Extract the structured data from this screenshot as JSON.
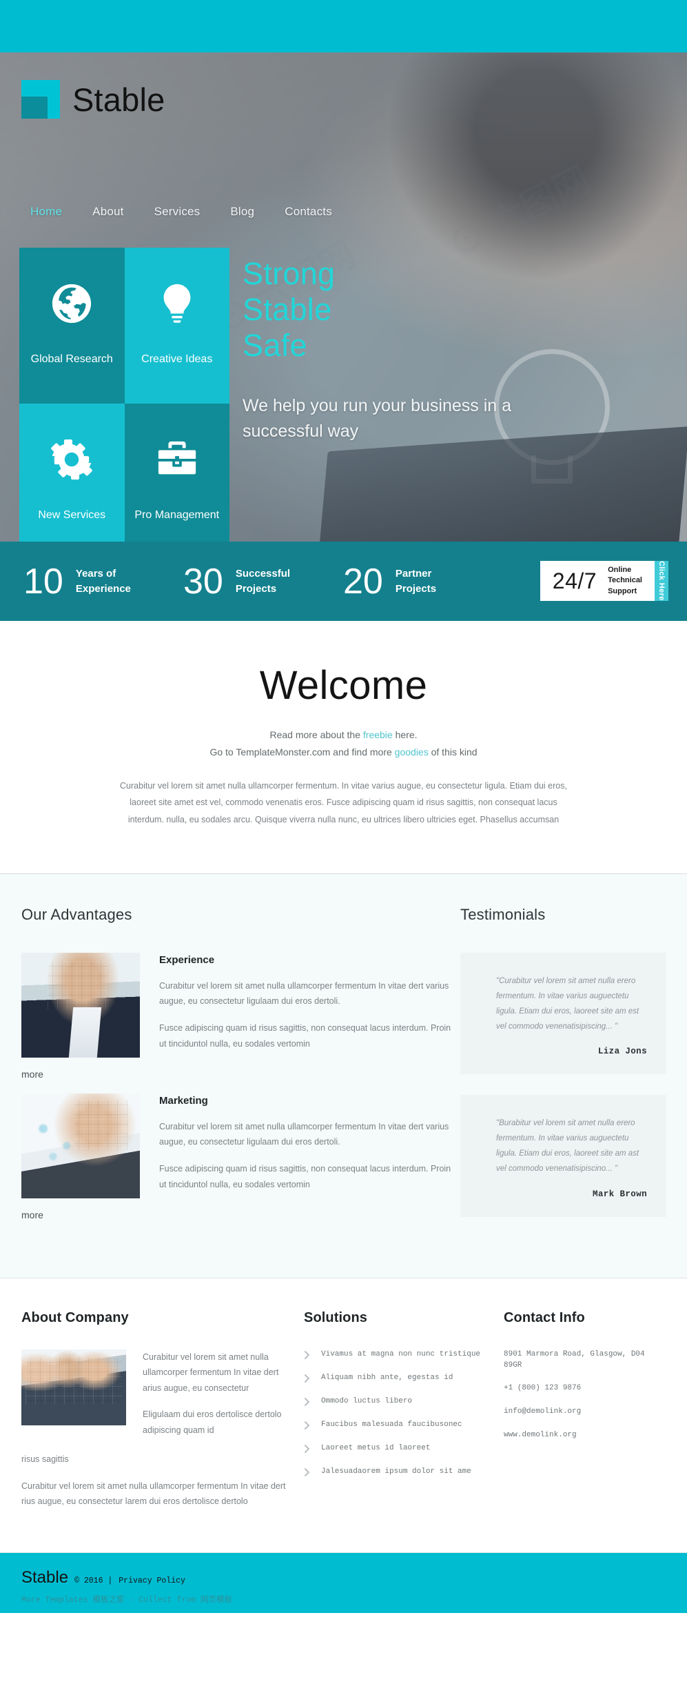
{
  "brand": {
    "name": "Stable"
  },
  "nav": {
    "items": [
      {
        "label": "Home",
        "active": true
      },
      {
        "label": "About",
        "active": false
      },
      {
        "label": "Services",
        "active": false
      },
      {
        "label": "Blog",
        "active": false
      },
      {
        "label": "Contacts",
        "active": false
      }
    ]
  },
  "tiles": [
    {
      "label": "Global Research",
      "icon": "globe-icon",
      "tone": "dark"
    },
    {
      "label": "Creative Ideas",
      "icon": "lightbulb-icon",
      "tone": "light"
    },
    {
      "label": "New Services",
      "icon": "gear-icon",
      "tone": "light"
    },
    {
      "label": "Pro Management",
      "icon": "briefcase-icon",
      "tone": "dark"
    }
  ],
  "hero": {
    "line1": "Strong",
    "line2": "Stable",
    "line3": "Safe",
    "subtitle": "We help you run your business in a successful way"
  },
  "stats": [
    {
      "number": "10",
      "label": "Years of Experience"
    },
    {
      "number": "30",
      "label": "Successful Projects"
    },
    {
      "number": "20",
      "label": "Partner Projects"
    }
  ],
  "support": {
    "hours": "24/7",
    "line1": "Online",
    "line2": "Technical",
    "line3": "Support",
    "cta": "Click Here"
  },
  "welcome": {
    "title": "Welcome",
    "lead_pre": "Read more about the ",
    "lead_link1": "freebie",
    "lead_mid": " here.",
    "lead_line2_pre": "Go to TemplateMonster.com and find more ",
    "lead_link2": "goodies",
    "lead_line2_post": " of this kind",
    "body": "Curabitur vel lorem sit amet nulla ullamcorper fermentum. In vitae varius augue, eu consectetur ligula. Etiam dui eros, laoreet site amet est vel, commodo venenatis eros. Fusce adipiscing quam id risus sagittis, non consequat lacus interdum. nulla, eu sodales arcu. Quisque viverra nulla nunc, eu ultrices libero ultricies eget. Phasellus accumsan"
  },
  "advantages": {
    "heading": "Our Advantages",
    "items": [
      {
        "title": "Experience",
        "para1": "Curabitur vel lorem sit amet nulla ullamcorper fermentum In vitae dert varius augue, eu consectetur ligulaam dui eros dertoli.",
        "para2": "Fusce adipiscing quam id risus sagittis, non consequat lacus interdum. Proin ut tinciduntol nulla, eu sodales vertomin",
        "more": "more",
        "photo": "businesswoman-photo"
      },
      {
        "title": "Marketing",
        "para1": "Curabitur vel lorem sit amet nulla ullamcorper fermentum In vitae dert varius augue, eu consectetur ligulaam dui eros dertoli.",
        "para2": "Fusce adipiscing quam id risus sagittis, non consequat lacus interdum. Proin ut tinciduntol nulla, eu sodales vertomin",
        "more": "more",
        "photo": "businessman-chart-photo"
      }
    ]
  },
  "testimonials": {
    "heading": "Testimonials",
    "items": [
      {
        "quote": "\"Curabitur vel lorem sit amet nulla erero fermentum. In vitae varius auguectetu ligula. Etiam dui eros, laoreet site am est vel commodo venenatisipiscing... \"",
        "author": "Liza Jons"
      },
      {
        "quote": "\"Burabitur vel lorem sit amet nulla erero fermentum. In vitae varius auguectetu ligula. Etiam dui eros, laoreet site am ast vel commodo venenatisipiscino... \"",
        "author": "Mark Brown"
      }
    ]
  },
  "about_company": {
    "heading": "About Company",
    "para1": "Curabitur vel lorem sit amet nulla ullamcorper fermentum In vitae dert arius augue, eu consectetur",
    "para2": "Eligulaam dui eros dertolisce dertolo adipiscing quam id",
    "tail": "risus sagittis",
    "para3": "Curabitur vel lorem sit amet nulla ullamcorper fermentum In vitae dert rius augue, eu consectetur larem dui eros dertolisce dertolo",
    "photo": "team-meeting-photo"
  },
  "solutions": {
    "heading": "Solutions",
    "items": [
      "Vivamus at magna non nunc tristique",
      "Aliquam nibh ante, egestas id",
      "Ommodo luctus libero",
      "Faucibus malesuada faucibusonec",
      "Laoreet metus id laoreet",
      "Jalesuadaorem ipsum dolor sit ame"
    ]
  },
  "contact": {
    "heading": "Contact Info",
    "address": "8901 Marmora Road, Glasgow, D04 89GR",
    "phone": "+1 (800) 123 9876",
    "email": "info@demolink.org",
    "website": "www.demolink.org"
  },
  "bottom": {
    "brand": "Stable",
    "copyright": "© 2016  |",
    "privacy": "Privacy Policy",
    "credits": "More Templates 模板之家 - Collect from 网页模板"
  },
  "colors": {
    "cyan": "#00bcd1",
    "teal_dark": "#0f8c97",
    "teal_stats": "#14808d",
    "tile_light": "#16bfd0",
    "hero_accent": "#22d6d8"
  }
}
